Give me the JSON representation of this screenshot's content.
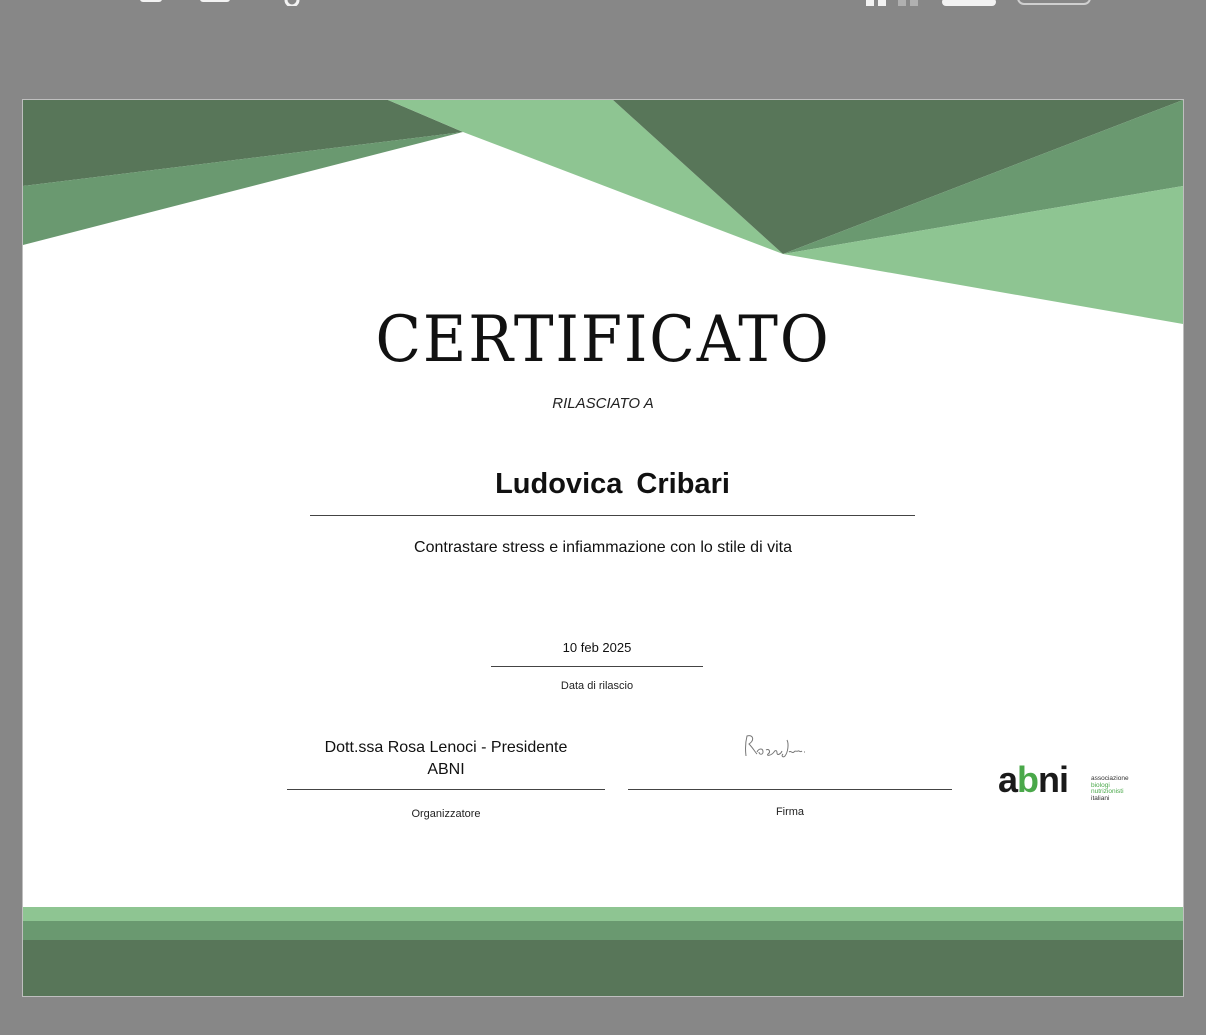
{
  "certificate": {
    "title": "CERTIFICATO",
    "subtitle": "RILASCIATO A",
    "recipient": "Ludovica  Cribari",
    "course": "Contrastare stress e infiammazione con lo stile di vita",
    "date": {
      "value": "10 feb 2025",
      "label": "Data di rilascio"
    },
    "organizer": {
      "name_line1": "Dott.ssa Rosa Lenoci - Presidente",
      "name_line2": "ABNI",
      "label": "Organizzatore"
    },
    "signature": {
      "label": "Firma"
    },
    "logo": {
      "word_a": "a",
      "word_b": "b",
      "word_ni": "ni",
      "sub": [
        "associazione",
        "biologi",
        "nutrizionisti",
        "italiani"
      ]
    }
  },
  "colors": {
    "dark_green": "#587659",
    "mid_green": "#6a9970",
    "light_green": "#8ec592",
    "logo_green": "#4aa84a",
    "frame_gray": "#878787"
  }
}
